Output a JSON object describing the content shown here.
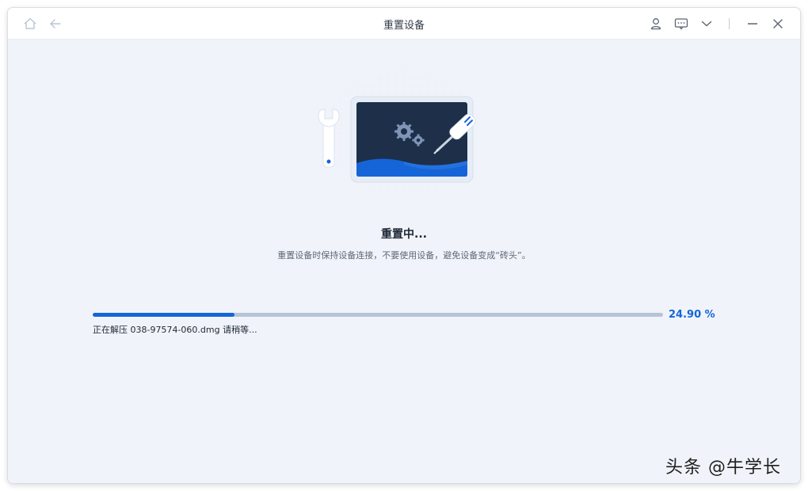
{
  "window": {
    "title": "重置设备",
    "icons": [
      "home-icon",
      "back-arrow-icon",
      "user-icon",
      "feedback-icon",
      "chevron-down-icon",
      "minimize-icon",
      "close-icon"
    ]
  },
  "status": {
    "title": "重置中...",
    "subtitle": "重置设备时保持设备连接，不要使用设备，避免设备变成“砖头”。"
  },
  "progress": {
    "fraction": 0.249,
    "percent_label": "24.90 %",
    "message": "正在解压 038-97574-060.dmg 请稍等..."
  },
  "watermark": {
    "text": "头条 @牛学长"
  },
  "colors": {
    "accent": "#1565d8",
    "background": "#f0f4fa",
    "track": "#b7c4d6"
  }
}
